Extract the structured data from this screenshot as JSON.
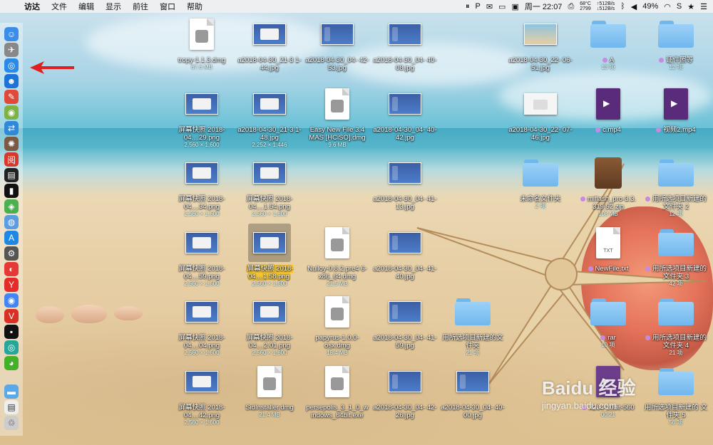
{
  "menubar": {
    "app": "访达",
    "menus": [
      "文件",
      "编辑",
      "显示",
      "前往",
      "窗口",
      "帮助"
    ],
    "cpu_temp": "68°C",
    "cpu_speed": "2799",
    "net_up": "↑512B/s",
    "net_down": "↓512B/s",
    "datetime": "周一 22:07",
    "battery": "49%"
  },
  "desktop": {
    "icons": [
      {
        "label": "tropy-1.1.3.dmg",
        "meta": "67.6 MB"
      },
      {
        "label": "a2018-04-30_21-3 1-44.jpg",
        "meta": ""
      },
      {
        "label": "a2018-04-30_04- 42-53.jpg",
        "meta": ""
      },
      {
        "label": "a2018-04-30_04- 40-08.jpg",
        "meta": ""
      },
      {
        "label": "a2018-04-30_22- 06-51.jpg",
        "meta": ""
      },
      {
        "label": "A",
        "meta": "13 项"
      },
      {
        "label": "证件照等",
        "meta": "12 项"
      },
      {
        "label": "屏幕快照 2018-04....29.png",
        "meta": "2,560 × 1,600"
      },
      {
        "label": "a2018-04-30_21-3 1-48.jpg",
        "meta": "2,252 × 1,446"
      },
      {
        "label": "Easy New File 3.4 MAS [HCiSO].dmg",
        "meta": "9.6 MB"
      },
      {
        "label": "a2018-04-30_04- 40-42.jpg",
        "meta": ""
      },
      {
        "label": "a2018-04-30_22- 07-46.jpg",
        "meta": ""
      },
      {
        "label": "c.mp4",
        "meta": ""
      },
      {
        "label": "视频2.mp4",
        "meta": ""
      },
      {
        "label": "屏幕快照 2018-04....34.png",
        "meta": "2,560 × 1,600"
      },
      {
        "label": "屏幕快照 2018-04....1.54.png",
        "meta": "2,560 × 1,600"
      },
      {
        "label": "a2018-04-30_04- 41-13.jpg",
        "meta": ""
      },
      {
        "label": "未命名文件夹",
        "meta": "2 项"
      },
      {
        "label": "miflash_pro-3.3. 319.52.zip",
        "meta": "108 MB"
      },
      {
        "label": "用所选项目新建的 文件夹 2",
        "meta": "12 项"
      },
      {
        "label": "屏幕快照 2018-04....59.png",
        "meta": "2,560 × 1,600"
      },
      {
        "label": "屏幕快照 2018-04....1.58.png",
        "meta": "2,560 × 1,600"
      },
      {
        "label": "Nulloy-0.8.2.pre4 6-x86_64.dmg",
        "meta": "21.5 MB"
      },
      {
        "label": "a2018-04-30_04- 41-40.jpg",
        "meta": ""
      },
      {
        "label": "NewFile.txt",
        "meta": ""
      },
      {
        "label": "用所选项目新建的 文件夹 3",
        "meta": "42 项"
      },
      {
        "label": "屏幕快照 2018-04....04.png",
        "meta": "2,560 × 1,600"
      },
      {
        "label": "屏幕快照 2018-04....2.01.png",
        "meta": "2,560 × 1,600"
      },
      {
        "label": "papyrus-1.0.0- osx.dmg",
        "meta": "18.4 MB"
      },
      {
        "label": "a2018-04-30_04- 41-59.jpg",
        "meta": ""
      },
      {
        "label": "用所选项目新建的文 件夹",
        "meta": "21 项"
      },
      {
        "label": "rar",
        "meta": "10 项"
      },
      {
        "label": "用所选项目新建的 文件夹 4",
        "meta": "21 项"
      },
      {
        "label": "屏幕快照 2018-04....42.png",
        "meta": "2,560 × 1,600"
      },
      {
        "label": "SidInstaller.dmg",
        "meta": "21.4 MB"
      },
      {
        "label": "persepolis_3_1_0_w indows_64bit.exe",
        "meta": ""
      },
      {
        "label": "a2018-04-30_04- 42-26.jpg",
        "meta": ""
      },
      {
        "label": "a2018-04-30_04- 40-00.jpg",
        "meta": ""
      },
      {
        "label": "x264-10bit-560",
        "meta": "00:21"
      },
      {
        "label": "用所选项目新建的 文件夹 5",
        "meta": "56 项"
      }
    ],
    "doc_badge": "TXT"
  },
  "watermark": {
    "text": "Baidu 经验",
    "url": "jingyan.baidu.com"
  }
}
